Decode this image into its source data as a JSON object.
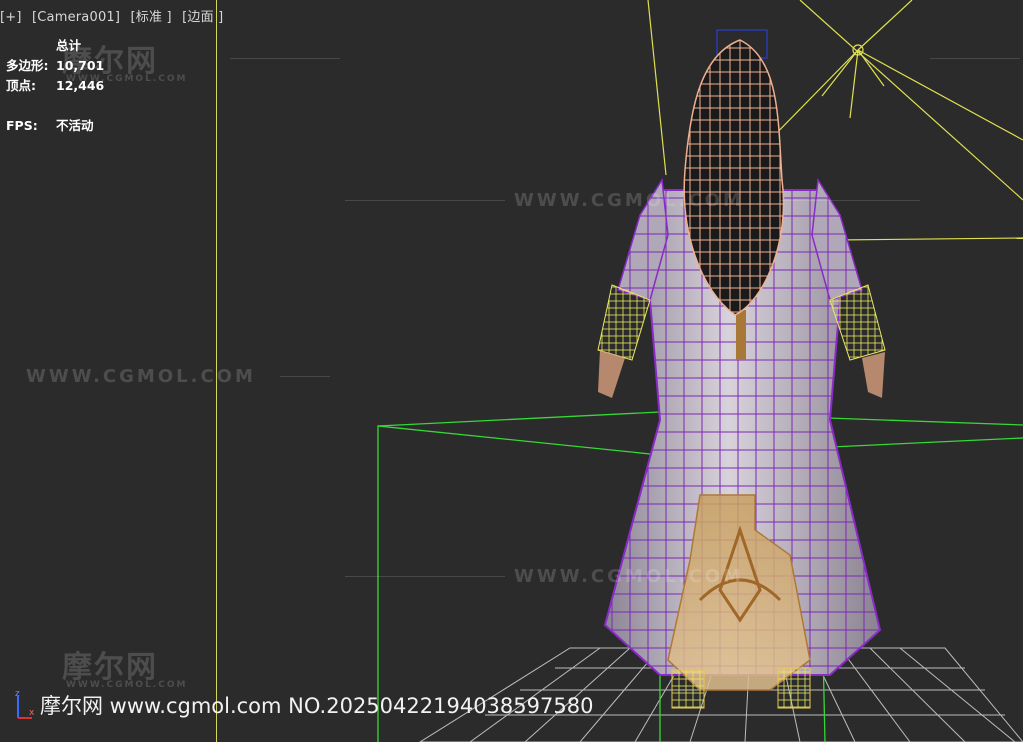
{
  "viewport": {
    "labels": [
      "[+]",
      "[Camera001]",
      "[标准 ]",
      "[边面 ]"
    ],
    "stats": {
      "header": "总计",
      "polygons_label": "多边形:",
      "polygons_value": "10,701",
      "vertices_label": "顶点:",
      "vertices_value": "12,446",
      "fps_label": "FPS:",
      "fps_value": "不活动"
    }
  },
  "watermarks": {
    "url": "WWW.CGMOL.COM",
    "brand": "摩尔网",
    "small": "WWW.CGMOL.COM"
  },
  "footer": {
    "text": "摩尔网 www.cgmol.com NO.20250422194038597580"
  },
  "axis": {
    "z_label": "z",
    "x_label": "x"
  },
  "colors": {
    "background": "#2b2b2b",
    "wire_purple": "#7a2ab0",
    "wire_yellow": "#e8e860",
    "wire_green": "#3ad83a",
    "hair_wire": "#f0b090",
    "grid": "#c8c8c8"
  }
}
